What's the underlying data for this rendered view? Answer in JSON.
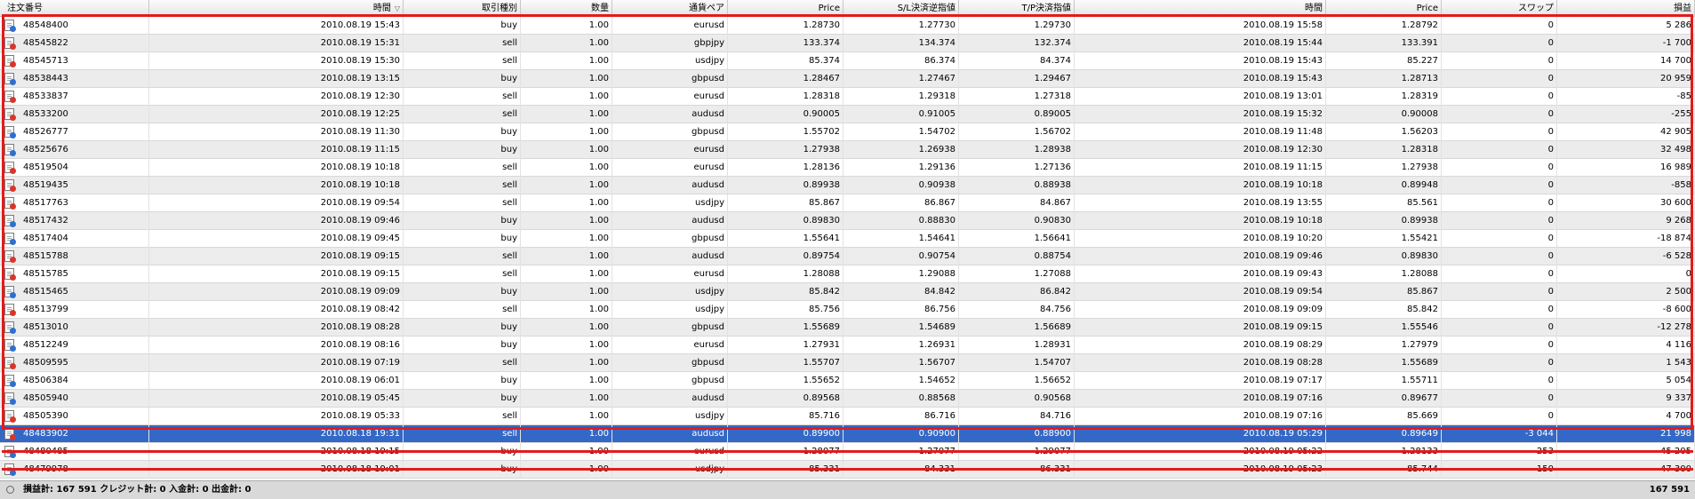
{
  "columns": [
    "注文番号",
    "時間",
    "取引種別",
    "数量",
    "通貨ペア",
    "Price",
    "S/L決済逆指値",
    "T/P決済指値",
    "時間",
    "Price",
    "スワップ",
    "損益"
  ],
  "rows": [
    {
      "id": "48548400",
      "open": "2010.08.19 15:43",
      "type": "buy",
      "qty": "1.00",
      "pair": "eurusd",
      "price": "1.28730",
      "sl": "1.27730",
      "tp": "1.29730",
      "close": "2010.08.19 15:58",
      "cprice": "1.28792",
      "swap": "0",
      "profit": "5 286"
    },
    {
      "id": "48545822",
      "open": "2010.08.19 15:31",
      "type": "sell",
      "qty": "1.00",
      "pair": "gbpjpy",
      "price": "133.374",
      "sl": "134.374",
      "tp": "132.374",
      "close": "2010.08.19 15:44",
      "cprice": "133.391",
      "swap": "0",
      "profit": "-1 700"
    },
    {
      "id": "48545713",
      "open": "2010.08.19 15:30",
      "type": "sell",
      "qty": "1.00",
      "pair": "usdjpy",
      "price": "85.374",
      "sl": "86.374",
      "tp": "84.374",
      "close": "2010.08.19 15:43",
      "cprice": "85.227",
      "swap": "0",
      "profit": "14 700"
    },
    {
      "id": "48538443",
      "open": "2010.08.19 13:15",
      "type": "buy",
      "qty": "1.00",
      "pair": "gbpusd",
      "price": "1.28467",
      "sl": "1.27467",
      "tp": "1.29467",
      "close": "2010.08.19 15:43",
      "cprice": "1.28713",
      "swap": "0",
      "profit": "20 959"
    },
    {
      "id": "48533837",
      "open": "2010.08.19 12:30",
      "type": "sell",
      "qty": "1.00",
      "pair": "eurusd",
      "price": "1.28318",
      "sl": "1.29318",
      "tp": "1.27318",
      "close": "2010.08.19 13:01",
      "cprice": "1.28319",
      "swap": "0",
      "profit": "-85"
    },
    {
      "id": "48533200",
      "open": "2010.08.19 12:25",
      "type": "sell",
      "qty": "1.00",
      "pair": "audusd",
      "price": "0.90005",
      "sl": "0.91005",
      "tp": "0.89005",
      "close": "2010.08.19 15:32",
      "cprice": "0.90008",
      "swap": "0",
      "profit": "-255"
    },
    {
      "id": "48526777",
      "open": "2010.08.19 11:30",
      "type": "buy",
      "qty": "1.00",
      "pair": "gbpusd",
      "price": "1.55702",
      "sl": "1.54702",
      "tp": "1.56702",
      "close": "2010.08.19 11:48",
      "cprice": "1.56203",
      "swap": "0",
      "profit": "42 905"
    },
    {
      "id": "48525676",
      "open": "2010.08.19 11:15",
      "type": "buy",
      "qty": "1.00",
      "pair": "eurusd",
      "price": "1.27938",
      "sl": "1.26938",
      "tp": "1.28938",
      "close": "2010.08.19 12:30",
      "cprice": "1.28318",
      "swap": "0",
      "profit": "32 498"
    },
    {
      "id": "48519504",
      "open": "2010.08.19 10:18",
      "type": "sell",
      "qty": "1.00",
      "pair": "eurusd",
      "price": "1.28136",
      "sl": "1.29136",
      "tp": "1.27136",
      "close": "2010.08.19 11:15",
      "cprice": "1.27938",
      "swap": "0",
      "profit": "16 989"
    },
    {
      "id": "48519435",
      "open": "2010.08.19 10:18",
      "type": "sell",
      "qty": "1.00",
      "pair": "audusd",
      "price": "0.89938",
      "sl": "0.90938",
      "tp": "0.88938",
      "close": "2010.08.19 10:18",
      "cprice": "0.89948",
      "swap": "0",
      "profit": "-858"
    },
    {
      "id": "48517763",
      "open": "2010.08.19 09:54",
      "type": "sell",
      "qty": "1.00",
      "pair": "usdjpy",
      "price": "85.867",
      "sl": "86.867",
      "tp": "84.867",
      "close": "2010.08.19 13:55",
      "cprice": "85.561",
      "swap": "0",
      "profit": "30 600"
    },
    {
      "id": "48517432",
      "open": "2010.08.19 09:46",
      "type": "buy",
      "qty": "1.00",
      "pair": "audusd",
      "price": "0.89830",
      "sl": "0.88830",
      "tp": "0.90830",
      "close": "2010.08.19 10:18",
      "cprice": "0.89938",
      "swap": "0",
      "profit": "9 268"
    },
    {
      "id": "48517404",
      "open": "2010.08.19 09:45",
      "type": "buy",
      "qty": "1.00",
      "pair": "gbpusd",
      "price": "1.55641",
      "sl": "1.54641",
      "tp": "1.56641",
      "close": "2010.08.19 10:20",
      "cprice": "1.55421",
      "swap": "0",
      "profit": "-18 874"
    },
    {
      "id": "48515788",
      "open": "2010.08.19 09:15",
      "type": "sell",
      "qty": "1.00",
      "pair": "audusd",
      "price": "0.89754",
      "sl": "0.90754",
      "tp": "0.88754",
      "close": "2010.08.19 09:46",
      "cprice": "0.89830",
      "swap": "0",
      "profit": "-6 528"
    },
    {
      "id": "48515785",
      "open": "2010.08.19 09:15",
      "type": "sell",
      "qty": "1.00",
      "pair": "eurusd",
      "price": "1.28088",
      "sl": "1.29088",
      "tp": "1.27088",
      "close": "2010.08.19 09:43",
      "cprice": "1.28088",
      "swap": "0",
      "profit": "0"
    },
    {
      "id": "48515465",
      "open": "2010.08.19 09:09",
      "type": "buy",
      "qty": "1.00",
      "pair": "usdjpy",
      "price": "85.842",
      "sl": "84.842",
      "tp": "86.842",
      "close": "2010.08.19 09:54",
      "cprice": "85.867",
      "swap": "0",
      "profit": "2 500"
    },
    {
      "id": "48513799",
      "open": "2010.08.19 08:42",
      "type": "sell",
      "qty": "1.00",
      "pair": "usdjpy",
      "price": "85.756",
      "sl": "86.756",
      "tp": "84.756",
      "close": "2010.08.19 09:09",
      "cprice": "85.842",
      "swap": "0",
      "profit": "-8 600"
    },
    {
      "id": "48513010",
      "open": "2010.08.19 08:28",
      "type": "buy",
      "qty": "1.00",
      "pair": "gbpusd",
      "price": "1.55689",
      "sl": "1.54689",
      "tp": "1.56689",
      "close": "2010.08.19 09:15",
      "cprice": "1.55546",
      "swap": "0",
      "profit": "-12 278"
    },
    {
      "id": "48512249",
      "open": "2010.08.19 08:16",
      "type": "buy",
      "qty": "1.00",
      "pair": "eurusd",
      "price": "1.27931",
      "sl": "1.26931",
      "tp": "1.28931",
      "close": "2010.08.19 08:29",
      "cprice": "1.27979",
      "swap": "0",
      "profit": "4 116"
    },
    {
      "id": "48509595",
      "open": "2010.08.19 07:19",
      "type": "sell",
      "qty": "1.00",
      "pair": "gbpusd",
      "price": "1.55707",
      "sl": "1.56707",
      "tp": "1.54707",
      "close": "2010.08.19 08:28",
      "cprice": "1.55689",
      "swap": "0",
      "profit": "1 543"
    },
    {
      "id": "48506384",
      "open": "2010.08.19 06:01",
      "type": "buy",
      "qty": "1.00",
      "pair": "gbpusd",
      "price": "1.55652",
      "sl": "1.54652",
      "tp": "1.56652",
      "close": "2010.08.19 07:17",
      "cprice": "1.55711",
      "swap": "0",
      "profit": "5 054"
    },
    {
      "id": "48505940",
      "open": "2010.08.19 05:45",
      "type": "buy",
      "qty": "1.00",
      "pair": "audusd",
      "price": "0.89568",
      "sl": "0.88568",
      "tp": "0.90568",
      "close": "2010.08.19 07:16",
      "cprice": "0.89677",
      "swap": "0",
      "profit": "9 337"
    },
    {
      "id": "48505390",
      "open": "2010.08.19 05:33",
      "type": "sell",
      "qty": "1.00",
      "pair": "usdjpy",
      "price": "85.716",
      "sl": "86.716",
      "tp": "84.716",
      "close": "2010.08.19 07:16",
      "cprice": "85.669",
      "swap": "0",
      "profit": "4 700"
    },
    {
      "id": "48483902",
      "open": "2010.08.18 19:31",
      "type": "sell",
      "qty": "1.00",
      "pair": "audusd",
      "price": "0.89900",
      "sl": "0.90900",
      "tp": "0.88900",
      "close": "2010.08.19 05:29",
      "cprice": "0.89649",
      "swap": "-3 044",
      "profit": "21 998",
      "selected": true
    },
    {
      "id": "48480485",
      "open": "2010.08.18 19:15",
      "type": "buy",
      "qty": "1.00",
      "pair": "eurusd",
      "price": "1.28077",
      "sl": "1.27077",
      "tp": "1.29077",
      "close": "2010.08.19 05:22",
      "cprice": "1.28133",
      "swap": "-253",
      "profit": "45 205"
    },
    {
      "id": "48479978",
      "open": "2010.08.18 19:01",
      "type": "buy",
      "qty": "1.00",
      "pair": "usdjpy",
      "price": "85.331",
      "sl": "84.331",
      "tp": "86.331",
      "close": "2010.08.19 05:23",
      "cprice": "85.744",
      "swap": "-150",
      "profit": "47 300"
    }
  ],
  "status": {
    "summary": "損益計: 167 591  クレジット計: 0  入金計: 0  出金計: 0",
    "total": "167 591"
  },
  "colors": {
    "selected_row": "#3468c6",
    "buy_mark": "#2f6fd0",
    "sell_mark": "#d8362b",
    "highlight": "#e31b1b"
  }
}
